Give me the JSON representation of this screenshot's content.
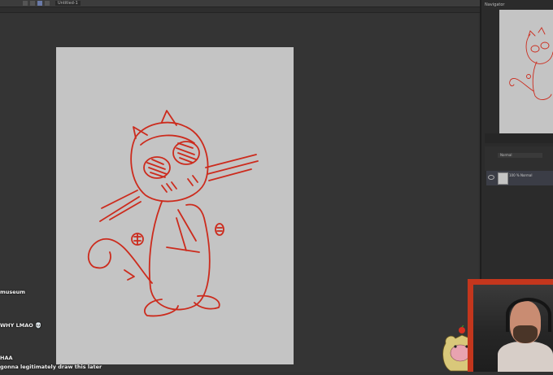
{
  "app": {
    "document_tab": "Untitled-1",
    "navigator_title": "Navigator",
    "layer_panel": {
      "blend_mode": "Normal",
      "layer_name": "100 % Normal"
    }
  },
  "chat": {
    "messages": [
      {
        "text": "museum"
      },
      {
        "text": "WHY LMAO 💀"
      },
      {
        "text": "HAA"
      },
      {
        "text": "gonna legitimately draw this later"
      }
    ]
  },
  "colors": {
    "sketch_stroke": "#cc2b1d",
    "canvas": "#c4c4c4",
    "webcam_border": "#c3361d"
  }
}
